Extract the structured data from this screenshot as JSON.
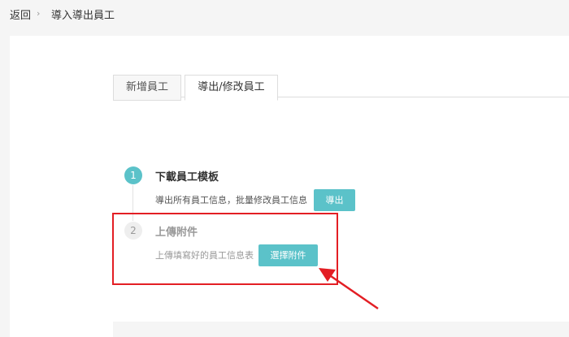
{
  "breadcrumb": {
    "back_label": "返回",
    "separator": "›",
    "current": "導入導出員工"
  },
  "tabs": [
    {
      "label": "新增員工",
      "active": false
    },
    {
      "label": "導出/修改員工",
      "active": true
    }
  ],
  "steps": [
    {
      "number": "1",
      "title": "下載員工模板",
      "description": "導出所有員工信息，批量修改員工信息",
      "button_label": "導出"
    },
    {
      "number": "2",
      "title": "上傳附件",
      "description": "上傳填寫好的員工信息表",
      "button_label": "選擇附件"
    }
  ],
  "colors": {
    "accent": "#5bc2c9",
    "highlight": "#e31e24"
  }
}
